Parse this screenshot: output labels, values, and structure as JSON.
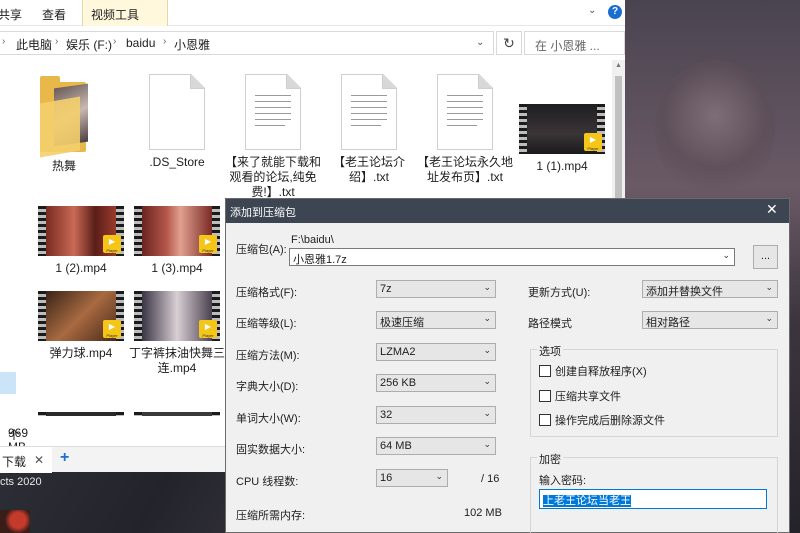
{
  "ribbon": {
    "tab_share": "共享",
    "tab_view": "查看",
    "tab_video": "视频工具"
  },
  "address": {
    "crumbs": [
      "此电脑",
      "娱乐 (F:)",
      "baidu",
      "小恩雅"
    ],
    "search_placeholder": "在 小恩雅 ..."
  },
  "files": [
    {
      "name": "热舞",
      "type": "folder"
    },
    {
      "name": ".DS_Store",
      "type": "file"
    },
    {
      "name": "【来了就能下载和观看的论坛,纯免费!】.txt",
      "type": "txt"
    },
    {
      "name": "【老王论坛介绍】.txt",
      "type": "txt"
    },
    {
      "name": "【老王论坛永久地址发布页】.txt",
      "type": "txt"
    },
    {
      "name": "1 (1).mp4",
      "type": "video"
    },
    {
      "name": "1 (2).mp4",
      "type": "video"
    },
    {
      "name": "1 (3).mp4",
      "type": "video"
    },
    {
      "name": "弹力球.mp4",
      "type": "video"
    },
    {
      "name": "丁字裤抹油快舞三连.mp4",
      "type": "video"
    }
  ],
  "video_badge": "Player",
  "status": {
    "count": "个项目",
    "size": "969 MB"
  },
  "tabbar": {
    "tab": "下载",
    "close": "✕",
    "add": "+"
  },
  "taskbar": {
    "text": "cts 2020"
  },
  "dialog": {
    "title": "添加到压缩包",
    "archive_label": "压缩包(A):",
    "archive_path": "F:\\baidu\\",
    "archive_name": "小恩雅1.7z",
    "browse": "...",
    "format_label": "压缩格式(F):",
    "format": "7z",
    "level_label": "压缩等级(L):",
    "level": "极速压缩",
    "method_label": "压缩方法(M):",
    "method": "LZMA2",
    "dict_label": "字典大小(D):",
    "dict": "256 KB",
    "word_label": "单词大小(W):",
    "word": "32",
    "solid_label": "固实数据大小:",
    "solid": "64 MB",
    "threads_label": "CPU 线程数:",
    "threads": "16",
    "threads_max": "/ 16",
    "memory_label": "压缩所需内存:",
    "memory": "102 MB",
    "update_label": "更新方式(U):",
    "update": "添加并替换文件",
    "path_label": "路径模式",
    "path": "相对路径",
    "options_title": "选项",
    "opt_sfx": "创建自释放程序(X)",
    "opt_shared": "压缩共享文件",
    "opt_delete": "操作完成后删除源文件",
    "encrypt_title": "加密",
    "password_label": "输入密码:",
    "password": "上老王论坛当老王"
  }
}
